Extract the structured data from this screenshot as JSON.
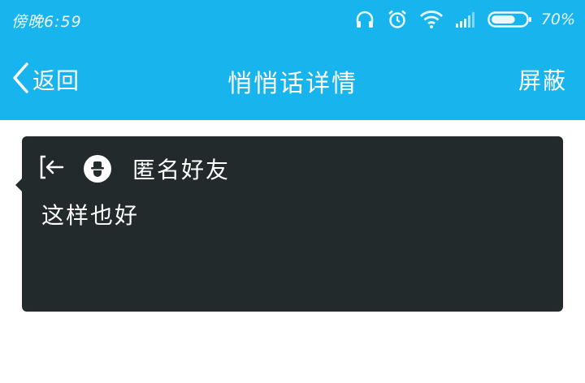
{
  "status_bar": {
    "time": "傍晚6:59",
    "battery_percent": "70%",
    "battery_level": 0.7,
    "icons": [
      "headphones-icon",
      "alarm-icon",
      "wifi-icon",
      "signal-icon",
      "battery-icon"
    ]
  },
  "nav": {
    "back_label": "返回",
    "title": "悄悄话详情",
    "block_label": "屏蔽"
  },
  "message": {
    "sender_icon": "exit-arrow-icon",
    "sender_avatar": "anonymous-avatar-icon",
    "sender_name": "匿名好友",
    "text": "这样也好"
  },
  "colors": {
    "header_bg": "#17b4ee",
    "card_bg": "#232a2c",
    "text_light": "#ffffff"
  }
}
